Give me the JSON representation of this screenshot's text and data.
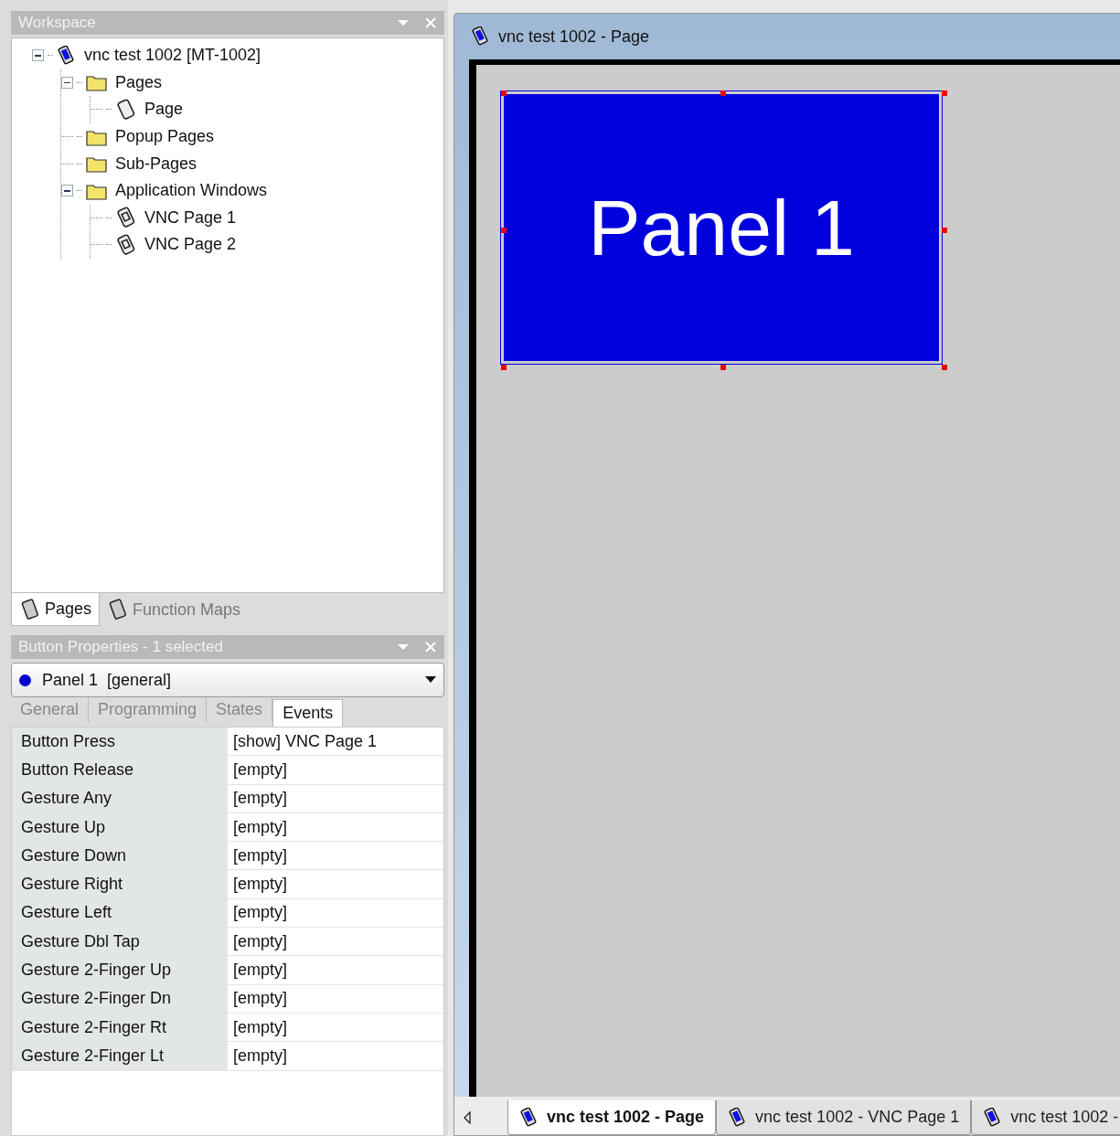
{
  "workspace": {
    "title": "Workspace",
    "tree": [
      {
        "label": "vnc test 1002 [MT-1002]",
        "kind": "device",
        "expanded": true,
        "children": [
          {
            "label": "Pages",
            "kind": "folder",
            "expanded": true,
            "children": [
              {
                "label": "Page",
                "kind": "page"
              }
            ]
          },
          {
            "label": "Popup Pages",
            "kind": "folder"
          },
          {
            "label": "Sub-Pages",
            "kind": "folder"
          },
          {
            "label": "Application Windows",
            "kind": "folder",
            "expanded": true,
            "children": [
              {
                "label": "VNC Page 1",
                "kind": "vnc"
              },
              {
                "label": "VNC Page 2",
                "kind": "vnc"
              }
            ]
          }
        ]
      }
    ],
    "tabs": [
      {
        "label": "Pages",
        "selected": true
      },
      {
        "label": "Function Maps",
        "selected": false
      }
    ]
  },
  "properties": {
    "title": "Button Properties - 1 selected",
    "selector": "Panel 1  [general]",
    "tabs": [
      {
        "label": "General",
        "selected": false
      },
      {
        "label": "Programming",
        "selected": false
      },
      {
        "label": "States",
        "selected": false
      },
      {
        "label": "Events",
        "selected": true
      }
    ],
    "rows": [
      {
        "name": "Button Press",
        "value": "[show] VNC Page 1"
      },
      {
        "name": "Button Release",
        "value": "[empty]"
      },
      {
        "name": "Gesture Any",
        "value": "[empty]"
      },
      {
        "name": "Gesture Up",
        "value": "[empty]"
      },
      {
        "name": "Gesture Down",
        "value": "[empty]"
      },
      {
        "name": "Gesture Right",
        "value": "[empty]"
      },
      {
        "name": "Gesture Left",
        "value": "[empty]"
      },
      {
        "name": "Gesture Dbl Tap",
        "value": "[empty]"
      },
      {
        "name": "Gesture 2-Finger Up",
        "value": "[empty]"
      },
      {
        "name": "Gesture 2-Finger Dn",
        "value": "[empty]"
      },
      {
        "name": "Gesture 2-Finger Rt",
        "value": "[empty]"
      },
      {
        "name": "Gesture 2-Finger Lt",
        "value": "[empty]"
      }
    ]
  },
  "editor": {
    "title": "vnc test 1002 - Page",
    "panel": {
      "label": "Panel 1",
      "selected": true
    },
    "tabs": [
      {
        "label": "vnc test 1002 - Page",
        "selected": true
      },
      {
        "label": "vnc test 1002 - VNC Page 1",
        "selected": false
      },
      {
        "label": "vnc test 1002 -",
        "selected": false
      }
    ]
  }
}
